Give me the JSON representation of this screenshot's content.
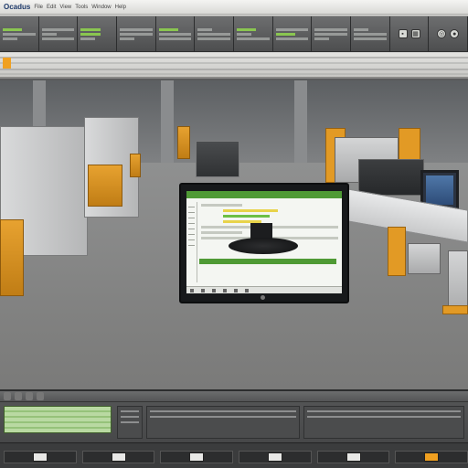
{
  "app": {
    "title": "Ocadus",
    "menu": [
      "File",
      "Edit",
      "View",
      "Tools",
      "Window",
      "Help"
    ]
  },
  "toolbar": {
    "group_count": 13,
    "accent_color": "#8fd14f"
  },
  "scene": {
    "monitor": {
      "window_title": "",
      "header_color": "#4f9a35"
    }
  },
  "timeline": {
    "tabs": [
      "",
      "",
      "",
      ""
    ]
  },
  "colors": {
    "accent_orange": "#f0a020",
    "accent_green": "#4f9a35",
    "panel_dark": "#4b4c4d"
  }
}
